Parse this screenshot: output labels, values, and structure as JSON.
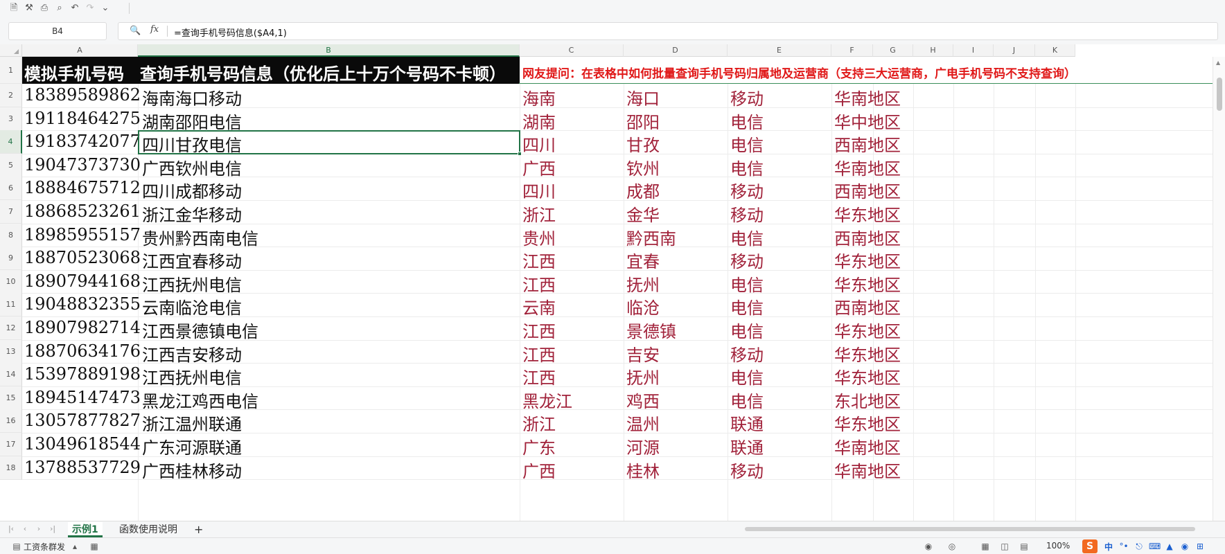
{
  "quick_access": {
    "icons": [
      "save-icon",
      "tools-icon",
      "print-icon",
      "print-preview-icon",
      "undo-icon",
      "redo-icon",
      "more-icon"
    ]
  },
  "formula_bar": {
    "name_box": "B4",
    "fx_label": "fx",
    "formula": "=查询手机号码信息($A4,1)"
  },
  "columns": [
    "A",
    "B",
    "C",
    "D",
    "E",
    "F",
    "G",
    "H",
    "I",
    "J",
    "K"
  ],
  "selected_column": "B",
  "selected_row": "4",
  "header_row": {
    "row": "1",
    "a": "模拟手机号码",
    "b": "查询手机号码信息（优化后上十万个号码不卡顿）",
    "c": "网友提问：在表格中如何批量查询手机号码归属地及运营商（支持三大运营商，广电手机号码不支持查询）"
  },
  "rows": [
    {
      "row": "2",
      "phone": "18389589862",
      "info": "海南海口移动",
      "province": "海南",
      "city": "海口",
      "carrier": "移动",
      "region": "华南地区"
    },
    {
      "row": "3",
      "phone": "19118464275",
      "info": "湖南邵阳电信",
      "province": "湖南",
      "city": "邵阳",
      "carrier": "电信",
      "region": "华中地区"
    },
    {
      "row": "4",
      "phone": "19183742077",
      "info": "四川甘孜电信",
      "province": "四川",
      "city": "甘孜",
      "carrier": "电信",
      "region": "西南地区"
    },
    {
      "row": "5",
      "phone": "19047373730",
      "info": "广西钦州电信",
      "province": "广西",
      "city": "钦州",
      "carrier": "电信",
      "region": "华南地区"
    },
    {
      "row": "6",
      "phone": "18884675712",
      "info": "四川成都移动",
      "province": "四川",
      "city": "成都",
      "carrier": "移动",
      "region": "西南地区"
    },
    {
      "row": "7",
      "phone": "18868523261",
      "info": "浙江金华移动",
      "province": "浙江",
      "city": "金华",
      "carrier": "移动",
      "region": "华东地区"
    },
    {
      "row": "8",
      "phone": "18985955157",
      "info": "贵州黔西南电信",
      "province": "贵州",
      "city": "黔西南",
      "carrier": "电信",
      "region": "西南地区"
    },
    {
      "row": "9",
      "phone": "18870523068",
      "info": "江西宜春移动",
      "province": "江西",
      "city": "宜春",
      "carrier": "移动",
      "region": "华东地区"
    },
    {
      "row": "10",
      "phone": "18907944168",
      "info": "江西抚州电信",
      "province": "江西",
      "city": "抚州",
      "carrier": "电信",
      "region": "华东地区"
    },
    {
      "row": "11",
      "phone": "19048832355",
      "info": "云南临沧电信",
      "province": "云南",
      "city": "临沧",
      "carrier": "电信",
      "region": "西南地区"
    },
    {
      "row": "12",
      "phone": "18907982714",
      "info": "江西景德镇电信",
      "province": "江西",
      "city": "景德镇",
      "carrier": "电信",
      "region": "华东地区"
    },
    {
      "row": "13",
      "phone": "18870634176",
      "info": "江西吉安移动",
      "province": "江西",
      "city": "吉安",
      "carrier": "移动",
      "region": "华东地区"
    },
    {
      "row": "14",
      "phone": "15397889198",
      "info": "江西抚州电信",
      "province": "江西",
      "city": "抚州",
      "carrier": "电信",
      "region": "华东地区"
    },
    {
      "row": "15",
      "phone": "18945147473",
      "info": "黑龙江鸡西电信",
      "province": "黑龙江",
      "city": "鸡西",
      "carrier": "电信",
      "region": "东北地区"
    },
    {
      "row": "16",
      "phone": "13057877827",
      "info": "浙江温州联通",
      "province": "浙江",
      "city": "温州",
      "carrier": "联通",
      "region": "华东地区"
    },
    {
      "row": "17",
      "phone": "13049618544",
      "info": "广东河源联通",
      "province": "广东",
      "city": "河源",
      "carrier": "联通",
      "region": "华南地区"
    },
    {
      "row": "18",
      "phone": "13788537729",
      "info": "广西桂林移动",
      "province": "广西",
      "city": "桂林",
      "carrier": "移动",
      "region": "华南地区"
    }
  ],
  "sheet_tabs": {
    "tabs": [
      "示例1",
      "函数使用说明"
    ],
    "active": "示例1",
    "add_label": "+"
  },
  "status_bar": {
    "left_label": "工资条群发",
    "zoom": "100%",
    "ime_label": "中"
  },
  "colors": {
    "accent": "#217346",
    "header_bg": "#0a0a0a",
    "header_question": "#e01818",
    "derived_text": "#a1223a"
  }
}
